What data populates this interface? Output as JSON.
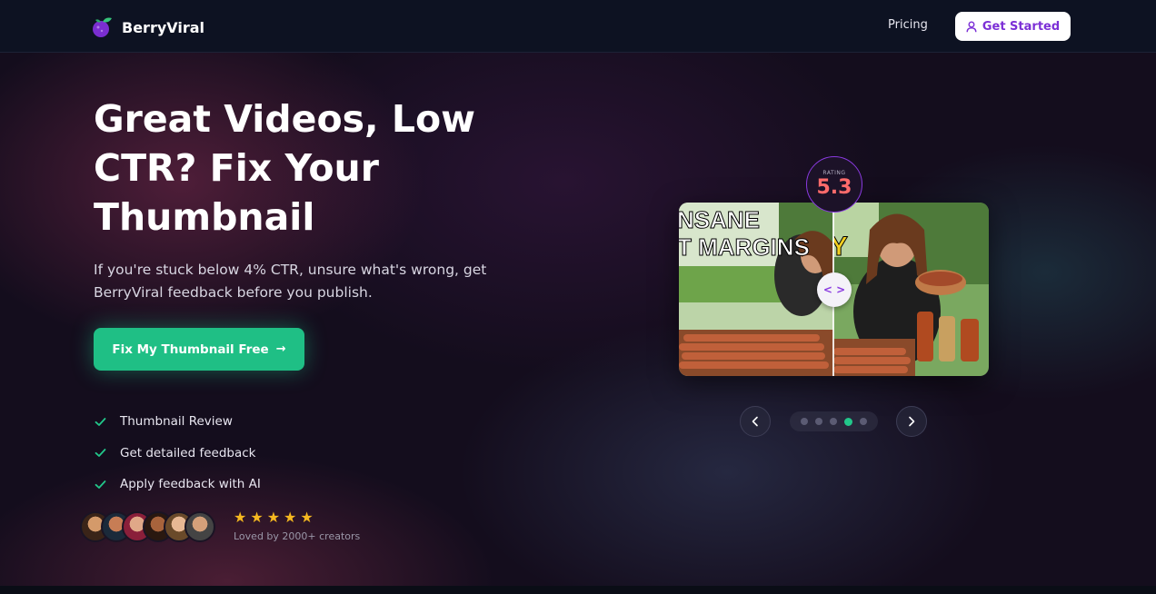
{
  "header": {
    "brand": "BerryViral",
    "nav_pricing": "Pricing",
    "get_started": "Get Started"
  },
  "hero": {
    "title": "Great Videos, Low CTR? Fix Your Thumbnail",
    "subtitle": "If you're stuck below 4% CTR, unsure what's wrong, get BerryViral feedback before you publish.",
    "cta_label": "Fix My Thumbnail Free",
    "features": [
      "Thumbnail Review",
      "Get detailed feedback",
      "Apply feedback with AI"
    ],
    "rating_stars": 5,
    "loved_by": "Loved by 2000+ creators"
  },
  "showcase": {
    "rating_label": "RATING",
    "rating_value": "5.3",
    "thumb_left_text_line1": "NSANE",
    "thumb_left_text_line2": "T MARGINS",
    "thumb_right_text": "Y",
    "dots_count": 5,
    "active_dot_index": 3
  },
  "colors": {
    "accent_green": "#1fbf85",
    "accent_purple": "#7c2fd6",
    "rating_red": "#ff6b6b",
    "star_gold": "#f5b820"
  }
}
